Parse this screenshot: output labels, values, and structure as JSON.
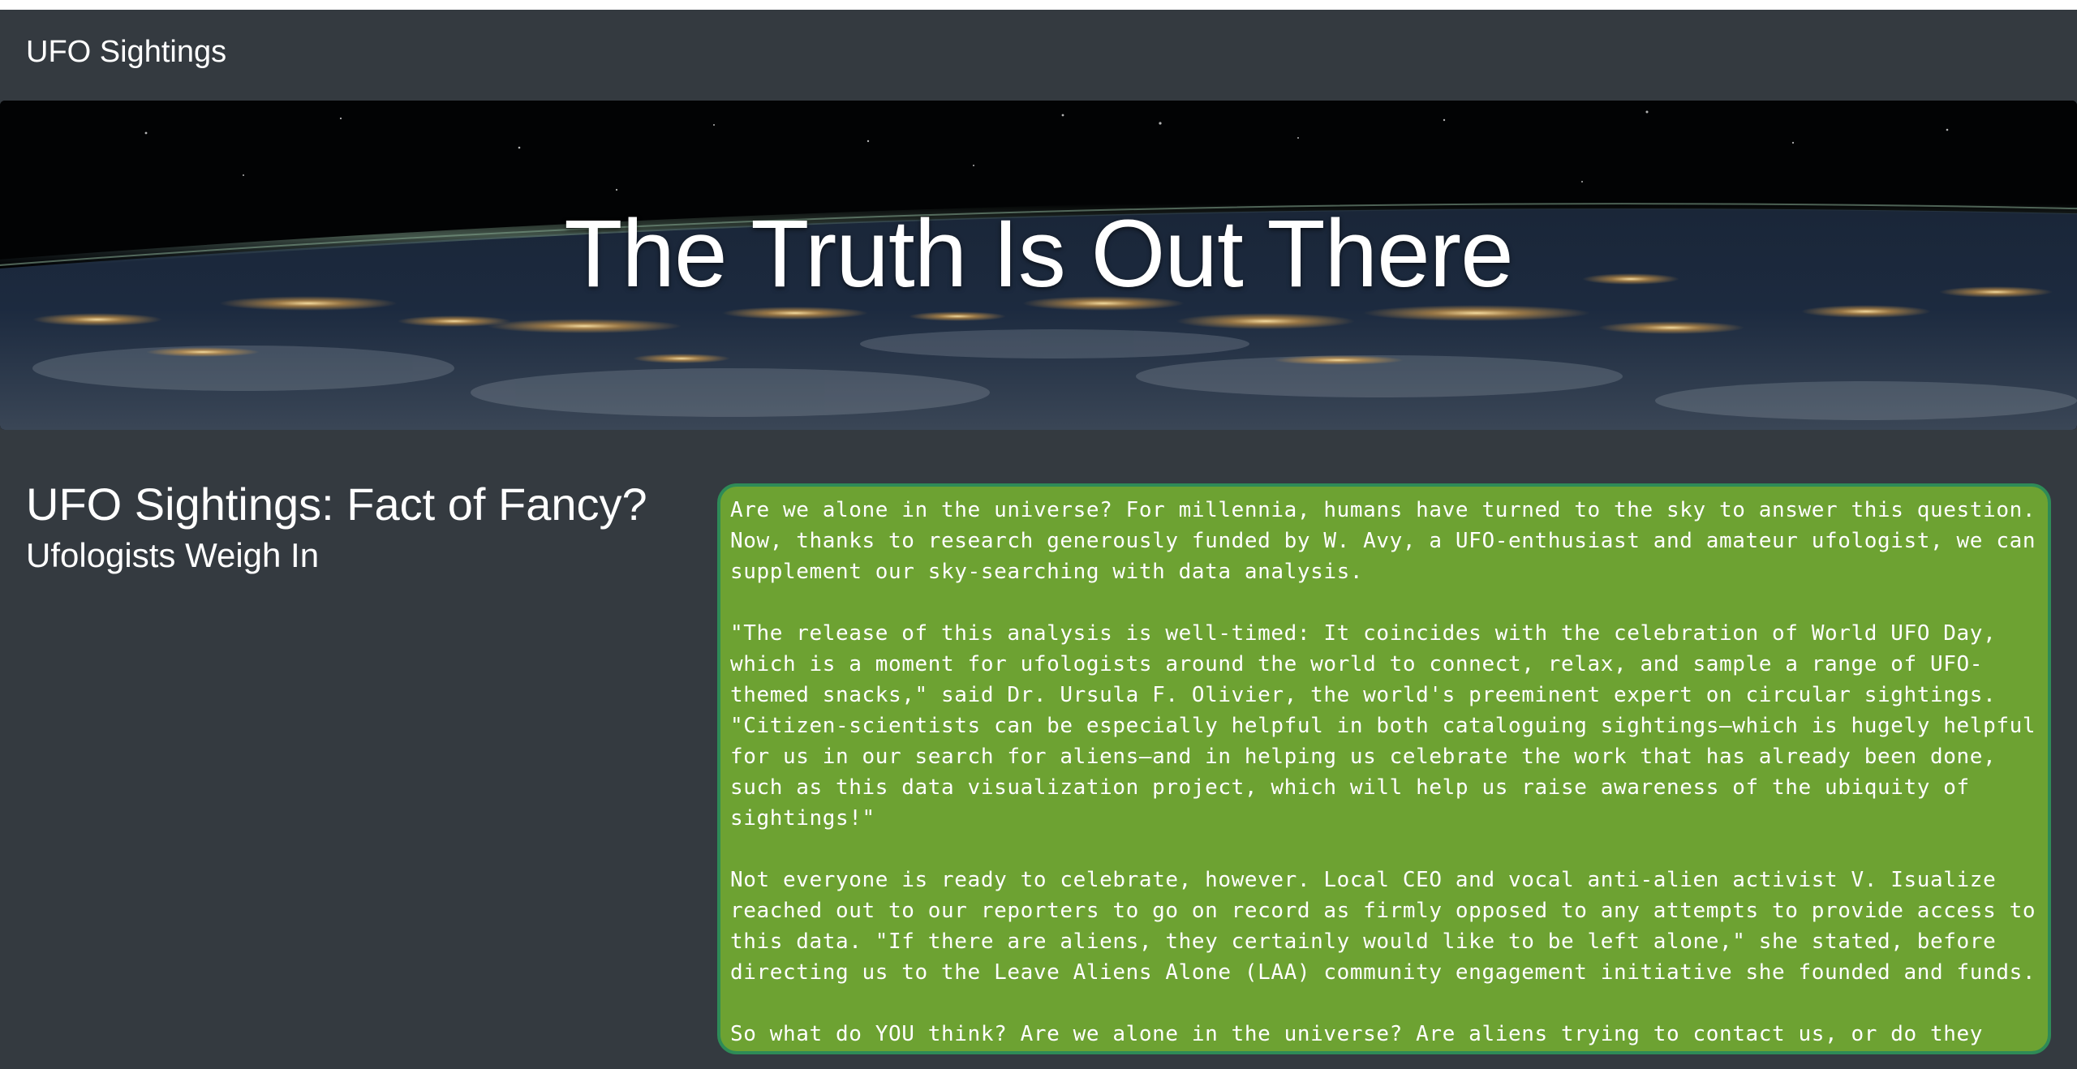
{
  "navbar": {
    "brand": "UFO Sightings"
  },
  "hero": {
    "title": "The Truth Is Out There"
  },
  "main": {
    "headline": "UFO Sightings: Fact of Fancy?",
    "subheadline": "Ufologists Weigh In",
    "paragraphs": [
      "Are we alone in the universe? For millennia, humans have turned to the sky to answer this question. Now, thanks to research generously funded by W. Avy, a UFO-enthusiast and amateur ufologist, we can supplement our sky-searching with data analysis.",
      "\"The release of this analysis is well-timed: It coincides with the celebration of World UFO Day, which is a moment for ufologists around the world to connect, relax, and sample a range of UFO-themed snacks,\" said Dr. Ursula F. Olivier, the world's preeminent expert on circular sightings. \"Citizen-scientists can be especially helpful in both cataloguing sightings—which is hugely helpful for us in our search for aliens—and in helping us celebrate the work that has already been done, such as this data visualization project, which will help us raise awareness of the ubiquity of sightings!\"",
      "Not everyone is ready to celebrate, however. Local CEO and vocal anti-alien activist V. Isualize reached out to our reporters to go on record as firmly opposed to any attempts to provide access to this data. \"If there are aliens, they certainly would like to be left alone,\" she stated, before directing us to the Leave Aliens Alone (LAA) community engagement initiative she founded and funds.",
      "So what do YOU think? Are we alone in the universe? Are aliens trying to contact us, or do they want to be left alone? Dig through the data yourself, and let us know what you see."
    ]
  },
  "colors": {
    "page_background": "#343a40",
    "article_background": "#6da232",
    "article_border": "#2e8b57",
    "text": "#ffffff"
  }
}
